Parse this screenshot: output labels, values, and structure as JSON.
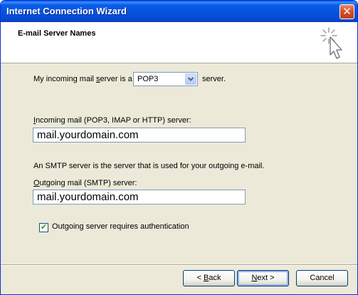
{
  "window": {
    "title": "Internet Connection Wizard",
    "close_glyph": "✕"
  },
  "header": {
    "title": "E-mail Server Names",
    "icon": "wizard-cursor-icon"
  },
  "incoming_type": {
    "label_pre": "My incoming mail ",
    "label_accel": "s",
    "label_post": "erver is a",
    "selected": "POP3",
    "label_after": "server."
  },
  "incoming_server": {
    "label_accel": "I",
    "label_rest": "ncoming mail (POP3, IMAP or HTTP) server:",
    "value": "mail.yourdomain.com"
  },
  "smtp_note": "An SMTP server is the server that is used for your outgoing e-mail.",
  "outgoing_server": {
    "label_accel": "O",
    "label_rest": "utgoing mail (SMTP) server:",
    "value": "mail.yourdomain.com"
  },
  "auth_checkbox": {
    "label": "Outgoing server requires authentication",
    "checked": true,
    "check_glyph": "✔"
  },
  "buttons": {
    "back_pre": "< ",
    "back_accel": "B",
    "back_rest": "ack",
    "next_accel": "N",
    "next_rest": "ext >",
    "cancel": "Cancel"
  },
  "colors": {
    "titlebar": "#0553e0",
    "dialog_bg": "#ece9d8",
    "checkmark": "#21a121"
  }
}
